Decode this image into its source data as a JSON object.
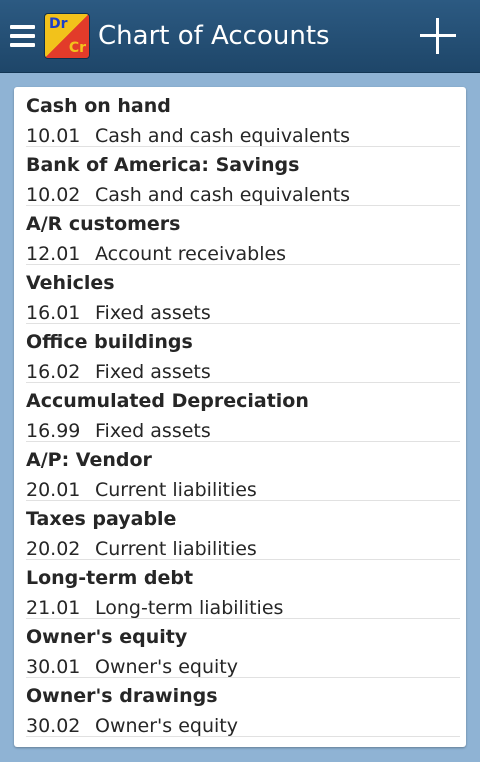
{
  "appbar": {
    "title": "Chart of Accounts",
    "logo_top": "Dr",
    "logo_bottom": "Cr",
    "menu_icon": "menu-icon",
    "add_icon": "plus-icon",
    "color": "#1e4669"
  },
  "accounts": [
    {
      "name": "Cash on hand",
      "code": "10.01",
      "category": "Cash and cash equivalents"
    },
    {
      "name": "Bank of America: Savings",
      "code": "10.02",
      "category": "Cash and cash equivalents"
    },
    {
      "name": "A/R customers",
      "code": "12.01",
      "category": "Account receivables"
    },
    {
      "name": "Vehicles",
      "code": "16.01",
      "category": "Fixed assets"
    },
    {
      "name": "Office buildings",
      "code": "16.02",
      "category": "Fixed assets"
    },
    {
      "name": "Accumulated Depreciation",
      "code": "16.99",
      "category": "Fixed assets"
    },
    {
      "name": "A/P: Vendor",
      "code": "20.01",
      "category": "Current liabilities"
    },
    {
      "name": "Taxes payable",
      "code": "20.02",
      "category": "Current liabilities"
    },
    {
      "name": "Long-term debt",
      "code": "21.01",
      "category": "Long-term liabilities"
    },
    {
      "name": "Owner's equity",
      "code": "30.01",
      "category": "Owner's equity"
    },
    {
      "name": "Owner's drawings",
      "code": "30.02",
      "category": "Owner's equity"
    }
  ]
}
